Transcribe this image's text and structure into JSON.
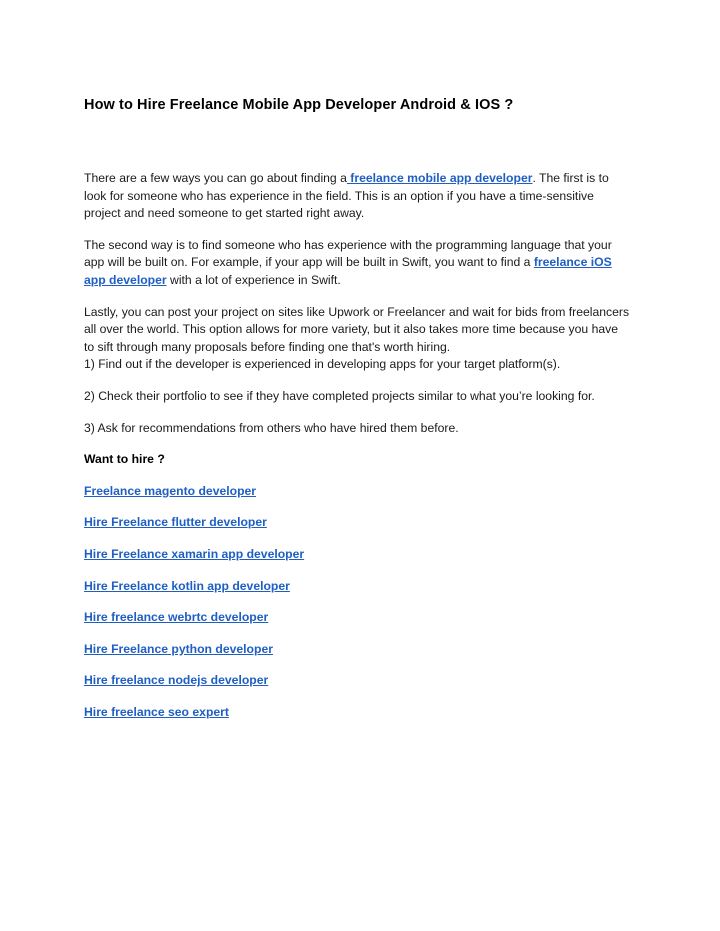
{
  "document": {
    "title": "How to Hire Freelance Mobile App Developer Android & IOS ?",
    "link_color": "#1f5fc4",
    "text_color": "#1a1a1a",
    "background_color": "#ffffff"
  },
  "paragraphs": {
    "p1_before": "There are a few ways you can go about finding a",
    "p1_link": " freelance mobile app developer",
    "p1_after": ". The first is to look for someone who has experience in the field. This is an option if you have a time-sensitive project and need someone to get started right away.",
    "p2_before": "The second way is to find someone who has experience with the programming language that your app will be built on. For example, if your app will be built in Swift, you want to find a ",
    "p2_link": "freelance iOS app developer",
    "p2_after": " with a lot of experience in Swift.",
    "p3": "Lastly, you can post your project on sites like Upwork or Freelancer and wait for bids from freelancers all over the world. This option allows for more variety, but it also takes more time because you have to sift through many proposals before finding one that's worth hiring."
  },
  "numbered_items": [
    "1) Find out if the developer is experienced in developing apps for your target platform(s).",
    "2) Check their portfolio to see if they have completed projects similar to what you’re looking for.",
    "3) Ask for recommendations from others who have hired them before."
  ],
  "cta": {
    "heading": "Want to hire ?",
    "links": [
      "Freelance magento developer",
      "Hire Freelance flutter developer",
      "Hire Freelance xamarin app developer",
      "Hire Freelance kotlin app developer",
      "Hire freelance webrtc developer",
      "Hire Freelance python developer",
      "Hire freelance nodejs developer",
      "Hire freelance seo expert"
    ]
  }
}
